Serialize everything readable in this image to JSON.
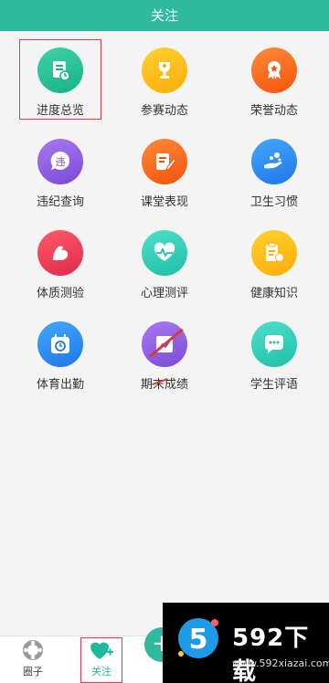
{
  "header": {
    "title": "关注"
  },
  "grid": {
    "items": [
      {
        "label": "进度总览",
        "icon": "progress-doc-icon",
        "color": "green"
      },
      {
        "label": "参赛动态",
        "icon": "trophy-icon",
        "color": "yellow"
      },
      {
        "label": "荣誉动态",
        "icon": "medal-icon",
        "color": "orange"
      },
      {
        "label": "违纪查询",
        "icon": "violation-badge-icon",
        "color": "purple"
      },
      {
        "label": "课堂表现",
        "icon": "notebook-pen-icon",
        "color": "orange"
      },
      {
        "label": "卫生习惯",
        "icon": "hand-wash-icon",
        "color": "blue"
      },
      {
        "label": "体质测验",
        "icon": "muscle-arm-icon",
        "color": "red"
      },
      {
        "label": "心理测评",
        "icon": "heartbeat-icon",
        "color": "teal"
      },
      {
        "label": "健康知识",
        "icon": "clipboard-apple-icon",
        "color": "yellow"
      },
      {
        "label": "体育出勤",
        "icon": "calendar-clock-icon",
        "color": "blue"
      },
      {
        "label": "期末成绩",
        "icon": "chart-report-icon",
        "color": "purple"
      },
      {
        "label": "学生评语",
        "icon": "chat-bubble-icon",
        "color": "teal"
      }
    ]
  },
  "bottom_nav": {
    "tabs": [
      {
        "label": "圈子",
        "icon": "circle-community-icon"
      },
      {
        "label": "关注",
        "icon": "heart-plus-icon"
      }
    ],
    "fab_icon": "add-icon"
  },
  "watermark": {
    "title": "592下载",
    "url": "www.592xiazai.com"
  }
}
